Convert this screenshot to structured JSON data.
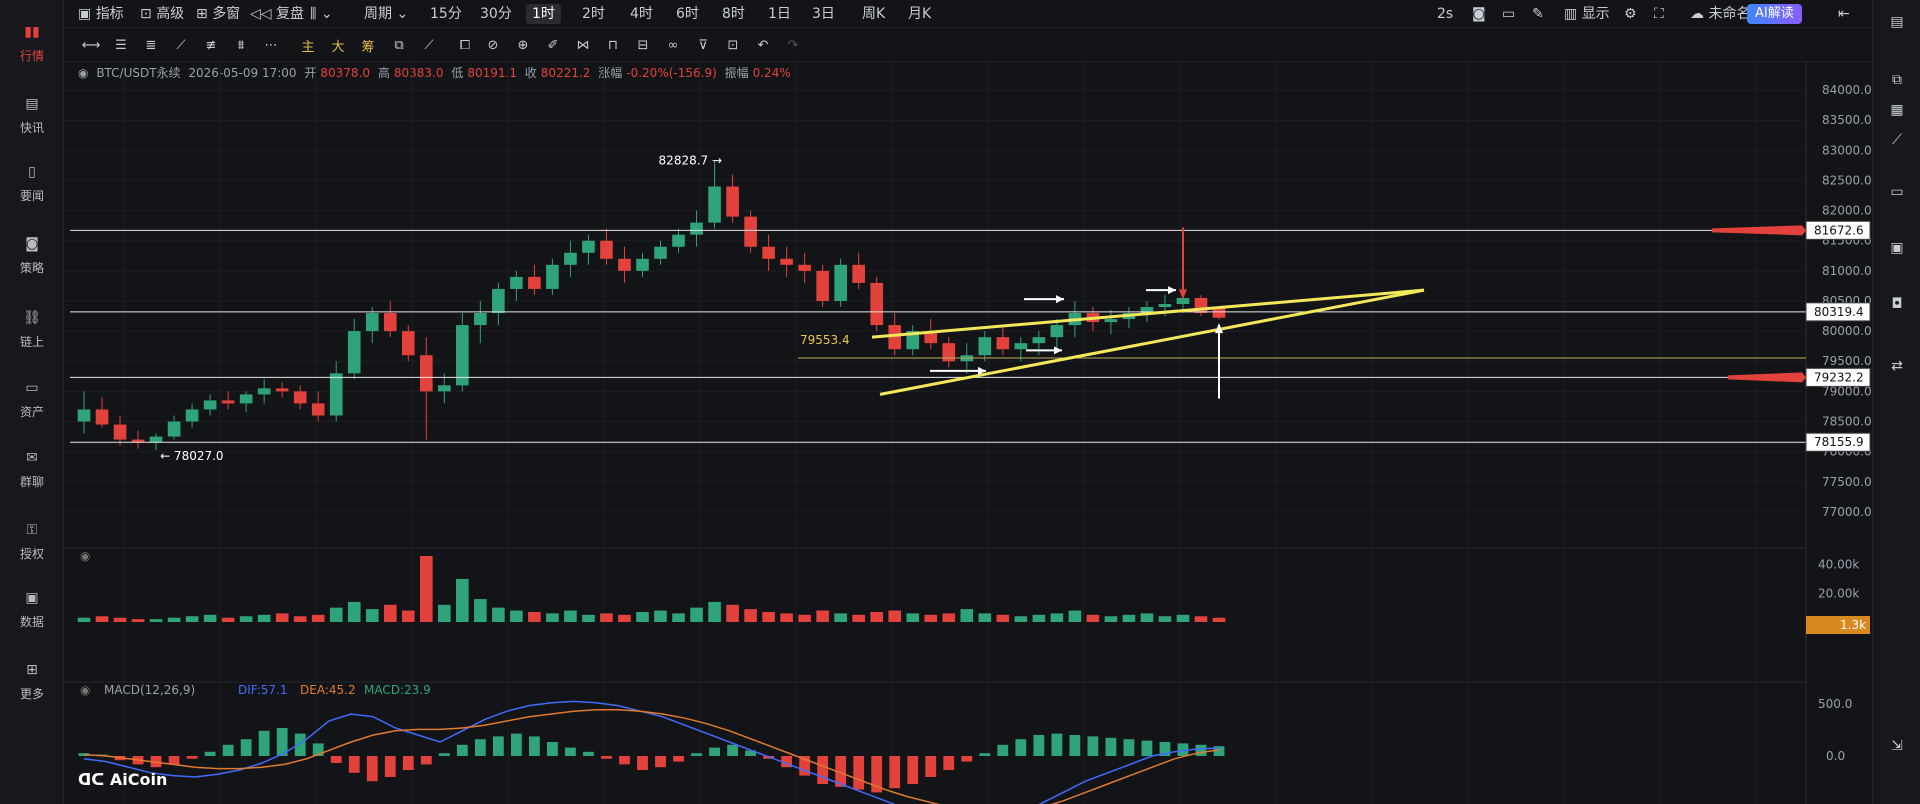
{
  "nav": [
    {
      "label": "行情",
      "icon": "bar-chart-icon",
      "active": true
    },
    {
      "label": "快讯",
      "icon": "news-flash-icon"
    },
    {
      "label": "要闻",
      "icon": "document-icon"
    },
    {
      "label": "策略",
      "icon": "robot-icon"
    },
    {
      "label": "链上",
      "icon": "chain-icon"
    },
    {
      "label": "资产",
      "icon": "wallet-icon"
    },
    {
      "label": "群聊",
      "icon": "chat-icon"
    },
    {
      "label": "授权",
      "icon": "key-icon"
    },
    {
      "label": "数据",
      "icon": "monitor-icon"
    },
    {
      "label": "更多",
      "icon": "grid-icon"
    }
  ],
  "top": {
    "indicators": "指标",
    "advanced": "高级",
    "multi": "多窗",
    "replay": "复盘",
    "period": "周期",
    "timeframes": [
      "15分",
      "30分",
      "1时",
      "2时",
      "4时",
      "6时",
      "8时",
      "1日",
      "3日",
      "周K",
      "月K"
    ],
    "active_timeframe": "1时",
    "refresh": "2s",
    "display": "显示",
    "layout_name": "未命名",
    "ai_label": "AI解读"
  },
  "drawing_tools": {
    "main": "主",
    "big": "大",
    "chip": "筹"
  },
  "info": {
    "symbol": "BTC/USDT永续",
    "datetime": "2026-05-09 17:00",
    "open_label": "开",
    "open": "80378.0",
    "high_label": "高",
    "high": "80383.0",
    "low_label": "低",
    "low": "80191.1",
    "close_label": "收",
    "close": "80221.2",
    "change_label": "涨幅",
    "change": "-0.20%(-156.9)",
    "amp_label": "振幅",
    "amp": "0.24%"
  },
  "chart_data": {
    "type": "candlestick",
    "symbol": "BTC/USDT永续",
    "interval": "1h",
    "ylim": [
      76600,
      84300
    ],
    "y_ticks": [
      "84000.0",
      "83500.0",
      "83000.0",
      "82500.0",
      "82000.0",
      "81500.0",
      "81000.0",
      "80500.0",
      "80000.0",
      "79500.0",
      "79000.0",
      "78500.0",
      "78000.0",
      "77500.0",
      "77000.0"
    ],
    "candles_ohlc": [
      [
        78500,
        79000,
        78300,
        78700
      ],
      [
        78700,
        78900,
        78400,
        78450
      ],
      [
        78450,
        78600,
        78100,
        78200
      ],
      [
        78200,
        78350,
        78050,
        78150
      ],
      [
        78150,
        78300,
        78027,
        78250
      ],
      [
        78250,
        78600,
        78200,
        78500
      ],
      [
        78500,
        78800,
        78400,
        78700
      ],
      [
        78700,
        78950,
        78600,
        78850
      ],
      [
        78850,
        79000,
        78700,
        78800
      ],
      [
        78800,
        79000,
        78650,
        78950
      ],
      [
        78950,
        79200,
        78800,
        79050
      ],
      [
        79050,
        79150,
        78900,
        79000
      ],
      [
        79000,
        79100,
        78700,
        78800
      ],
      [
        78800,
        79000,
        78500,
        78600
      ],
      [
        78600,
        79500,
        78500,
        79300
      ],
      [
        79300,
        80200,
        79200,
        80000
      ],
      [
        80000,
        80400,
        79800,
        80300
      ],
      [
        80300,
        80500,
        79900,
        80000
      ],
      [
        80000,
        80100,
        79500,
        79600
      ],
      [
        79600,
        79900,
        78200,
        79000
      ],
      [
        79000,
        79300,
        78800,
        79100
      ],
      [
        79100,
        80300,
        79000,
        80100
      ],
      [
        80100,
        80500,
        79800,
        80300
      ],
      [
        80300,
        80800,
        80100,
        80700
      ],
      [
        80700,
        81000,
        80500,
        80900
      ],
      [
        80900,
        81100,
        80600,
        80700
      ],
      [
        80700,
        81200,
        80600,
        81100
      ],
      [
        81100,
        81500,
        80900,
        81300
      ],
      [
        81300,
        81600,
        81100,
        81500
      ],
      [
        81500,
        81700,
        81100,
        81200
      ],
      [
        81200,
        81400,
        80800,
        81000
      ],
      [
        81000,
        81300,
        80900,
        81200
      ],
      [
        81200,
        81500,
        81100,
        81400
      ],
      [
        81400,
        81700,
        81300,
        81600
      ],
      [
        81600,
        82000,
        81400,
        81800
      ],
      [
        81800,
        82828.7,
        81700,
        82400
      ],
      [
        82400,
        82600,
        81800,
        81900
      ],
      [
        81900,
        82000,
        81300,
        81400
      ],
      [
        81400,
        81600,
        81000,
        81200
      ],
      [
        81200,
        81400,
        80900,
        81100
      ],
      [
        81100,
        81300,
        80800,
        81000
      ],
      [
        81000,
        81100,
        80400,
        80500
      ],
      [
        80500,
        81200,
        80400,
        81100
      ],
      [
        81100,
        81300,
        80700,
        80800
      ],
      [
        80800,
        80900,
        80000,
        80100
      ],
      [
        80100,
        80300,
        79600,
        79700
      ],
      [
        79700,
        80100,
        79600,
        80000
      ],
      [
        80000,
        80200,
        79700,
        79800
      ],
      [
        79800,
        79900,
        79400,
        79500
      ],
      [
        79500,
        79800,
        79300,
        79600
      ],
      [
        79600,
        80000,
        79500,
        79900
      ],
      [
        79900,
        80100,
        79600,
        79700
      ],
      [
        79700,
        79900,
        79500,
        79800
      ],
      [
        79800,
        80000,
        79600,
        79900
      ],
      [
        79900,
        80200,
        79700,
        80100
      ],
      [
        80100,
        80500,
        79900,
        80300
      ],
      [
        80300,
        80400,
        80000,
        80150
      ],
      [
        80150,
        80350,
        79950,
        80200
      ],
      [
        80200,
        80400,
        80050,
        80300
      ],
      [
        80300,
        80500,
        80150,
        80400
      ],
      [
        80400,
        80600,
        80250,
        80450
      ],
      [
        80450,
        80700,
        80300,
        80550
      ],
      [
        80550,
        80600,
        80250,
        80300
      ],
      [
        80378,
        80383,
        80191.1,
        80221.2
      ]
    ],
    "annotations": {
      "high_label": "82828.7",
      "low_label": "78027.0",
      "mid_label": "79553.4"
    },
    "price_levels": [
      {
        "value": 81672.6,
        "label": "81672.6"
      },
      {
        "value": 80319.4,
        "label": "80319.4"
      },
      {
        "value": 79232.2,
        "label": "79232.2"
      },
      {
        "value": 78155.9,
        "label": "78155.9"
      }
    ],
    "volume": {
      "ylim": [
        0,
        46000
      ],
      "y_ticks": [
        "40.00k",
        "20.00k"
      ],
      "last_label": "1.3k",
      "values": [
        3,
        4,
        3,
        2,
        2,
        3,
        4,
        5,
        3,
        4,
        5,
        6,
        4,
        5,
        10,
        14,
        9,
        12,
        8,
        46,
        12,
        30,
        16,
        10,
        8,
        7,
        6,
        8,
        5,
        6,
        5,
        7,
        8,
        6,
        10,
        14,
        12,
        9,
        7,
        6,
        5,
        8,
        6,
        5,
        7,
        8,
        6,
        5,
        6,
        9,
        6,
        5,
        4,
        5,
        6,
        8,
        5,
        4,
        5,
        6,
        4,
        5,
        4,
        3
      ]
    },
    "macd": {
      "label": "MACD(12,26,9)",
      "dif_label": "DIF:57.1",
      "dea_label": "DEA:45.2",
      "macd_label": "MACD:23.9",
      "y_ticks": [
        "500.0",
        "0.0"
      ],
      "hist": [
        20,
        10,
        -30,
        -60,
        -80,
        -60,
        -20,
        30,
        80,
        120,
        180,
        200,
        160,
        90,
        -50,
        -120,
        -180,
        -150,
        -100,
        -60,
        20,
        80,
        120,
        140,
        160,
        140,
        100,
        60,
        30,
        -20,
        -60,
        -100,
        -80,
        -40,
        20,
        60,
        80,
        40,
        -20,
        -80,
        -140,
        -200,
        -220,
        -240,
        -260,
        -230,
        -200,
        -150,
        -100,
        -40,
        20,
        80,
        120,
        150,
        160,
        150,
        140,
        130,
        120,
        110,
        100,
        90,
        80,
        70
      ],
      "dif": [
        -20,
        -40,
        -80,
        -120,
        -140,
        -150,
        -130,
        -100,
        -50,
        20,
        120,
        250,
        300,
        280,
        200,
        150,
        100,
        180,
        260,
        320,
        360,
        380,
        390,
        380,
        360,
        320,
        280,
        220,
        160,
        100,
        40,
        -20,
        -80,
        -140,
        -200,
        -260,
        -320,
        -380,
        -420,
        -460,
        -480,
        -470,
        -420,
        -340,
        -260,
        -180,
        -120,
        -60,
        0,
        30,
        50,
        57
      ],
      "dea": [
        10,
        0,
        -20,
        -40,
        -60,
        -80,
        -90,
        -90,
        -80,
        -60,
        -20,
        40,
        100,
        150,
        180,
        190,
        190,
        200,
        220,
        250,
        280,
        300,
        320,
        330,
        330,
        320,
        300,
        270,
        230,
        180,
        120,
        60,
        0,
        -60,
        -120,
        -180,
        -240,
        -290,
        -330,
        -370,
        -400,
        -410,
        -400,
        -370,
        -320,
        -260,
        -200,
        -140,
        -80,
        -20,
        20,
        45
      ]
    }
  }
}
